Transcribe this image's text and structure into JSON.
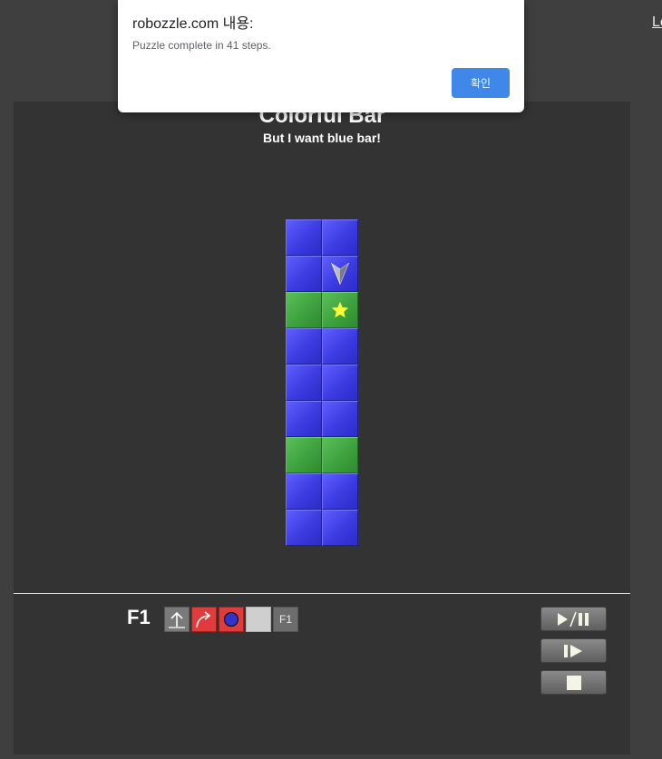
{
  "header": {
    "top_right_link": "Lo"
  },
  "puzzle": {
    "title": "Colorful Bar",
    "subtitle": "But I want blue bar!",
    "rows": [
      [
        "blue",
        "blue"
      ],
      [
        "blue",
        "blue"
      ],
      [
        "green",
        "green"
      ],
      [
        "blue",
        "blue"
      ],
      [
        "blue",
        "blue"
      ],
      [
        "blue",
        "blue"
      ],
      [
        "green",
        "green"
      ],
      [
        "blue",
        "blue"
      ],
      [
        "blue",
        "blue"
      ]
    ],
    "robot": {
      "row": 1,
      "col": 1,
      "direction": "down",
      "icon": "arrow-pointer-icon"
    },
    "star": {
      "row": 2,
      "col": 1,
      "color": "#ffff33"
    }
  },
  "program": {
    "function_label": "F1",
    "slots": [
      {
        "command": "forward",
        "condition": "gray",
        "icon": "forward-arrow-icon"
      },
      {
        "command": "turn-right",
        "condition": "red",
        "icon": "turn-right-icon"
      },
      {
        "command": "paint-blue",
        "condition": "red",
        "icon": "paint-dot-icon",
        "dot_color": "#3333cc"
      },
      {
        "command": "empty",
        "condition": "none",
        "icon": ""
      },
      {
        "command": "call",
        "condition": "gray",
        "label": "F1"
      }
    ]
  },
  "controls": {
    "play_pause_icon": "play-pause-icon",
    "step_icon": "step-icon",
    "stop_icon": "stop-icon"
  },
  "dialog": {
    "title": "robozzle.com 내용:",
    "message": "Puzzle complete in 41 steps.",
    "ok_label": "확인"
  },
  "colors": {
    "blue": "#3a3ae0",
    "green": "#3ea23e",
    "red": "#e03c3c",
    "panel": "#333333",
    "accent": "#3f87e8"
  }
}
